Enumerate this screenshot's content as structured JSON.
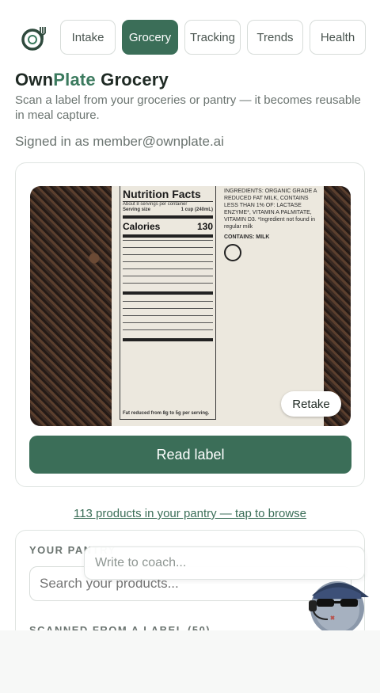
{
  "nav": {
    "tabs": [
      {
        "label": "Intake",
        "active": false
      },
      {
        "label": "Grocery",
        "active": true
      },
      {
        "label": "Tracking",
        "active": false
      },
      {
        "label": "Trends",
        "active": false
      },
      {
        "label": "Health",
        "active": false
      }
    ]
  },
  "header": {
    "brand_part1": "Own",
    "brand_part2": "Plate",
    "brand_part3": " Grocery",
    "subtitle": "Scan a label from your groceries or pantry — it becomes reusable in meal capture.",
    "signed_in": "Signed in as member@ownplate.ai"
  },
  "scan": {
    "photo_label": {
      "title": "Nutrition Facts",
      "servings": "About 8 servings per container",
      "serving_size": "Serving size",
      "serving_size_value": "1 cup (240mL)",
      "calories_label": "Calories",
      "calories_value": "130",
      "ingredients": "INGREDIENTS: ORGANIC GRADE A REDUCED FAT MILK, CONTAINS LESS THAN 1% OF: LACTASE ENZYME*, VITAMIN A PALMITATE, VITAMIN D3. *Ingredient not found in regular milk",
      "contains": "CONTAINS: MILK",
      "footer": "Fat reduced from 8g to 5g per serving."
    },
    "retake_label": "Retake",
    "read_label": "Read label"
  },
  "pantry": {
    "link_text": "113 products in your pantry — tap to browse",
    "section_title": "YOUR PANTRY",
    "search_placeholder": "Search your products...",
    "scanned_title": "SCANNED FROM A LABEL (50)"
  },
  "coach": {
    "placeholder": "Write to coach..."
  },
  "colors": {
    "accent": "#3b6e58",
    "brand_accent": "#3b7a5e"
  }
}
